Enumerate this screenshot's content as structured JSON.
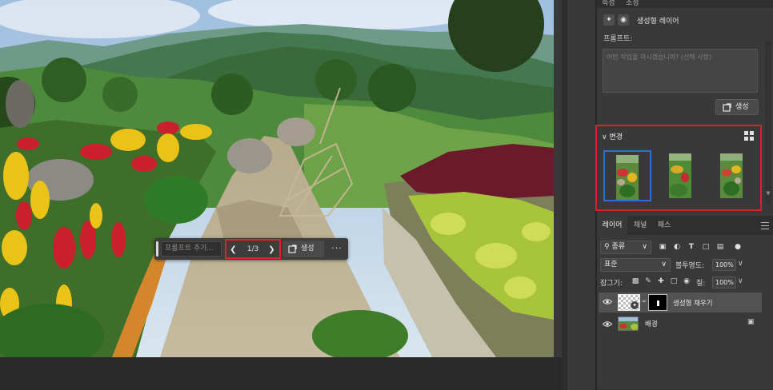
{
  "canvas": {
    "context_bar": {
      "prompt_placeholder": "프롬프트 추가...",
      "page_indicator": "1/3",
      "generate_label": "생성",
      "more_label": "···"
    }
  },
  "properties": {
    "tab_partial_1": "속성",
    "tab_partial_2": "조정",
    "layer_type_label": "생성형 레이어",
    "prompt_label": "프롬프트:",
    "prompt_placeholder": "어떤 작업을 하시겠습니까? (선택 사항)",
    "generate_label": "생성",
    "variations_header": "변경",
    "variations_count": 3,
    "selected_variation": 1
  },
  "layers_panel": {
    "tabs": [
      "레이어",
      "채널",
      "패스"
    ],
    "filter_kind": "종류",
    "blend_mode": "표준",
    "opacity_label": "불투명도:",
    "opacity_value": "100%",
    "lock_label": "잠그기:",
    "fill_label": "칠:",
    "fill_value": "100%",
    "layers": [
      {
        "name": "생성형 채우기",
        "selected": true
      },
      {
        "name": "배경",
        "selected": false,
        "locked": true
      }
    ]
  },
  "colors": {
    "highlight_red": "#d7222b",
    "selection_blue": "#2f6fd4",
    "panel_bg": "#393939"
  },
  "icons": [
    "chevron-left-icon",
    "chevron-right-icon",
    "generate-icon",
    "more-icon",
    "wand-icon",
    "mask-icon",
    "grid-view-icon",
    "eye-icon",
    "lock-icon",
    "search-icon",
    "menu-icon"
  ]
}
